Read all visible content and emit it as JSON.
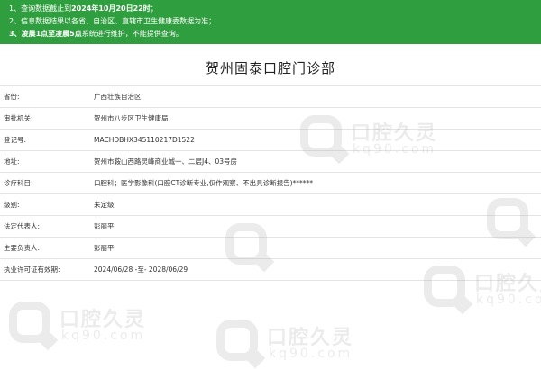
{
  "notice": {
    "lines": [
      {
        "prefix": "1、查询数据截止到",
        "date": "2024年10月20日22时",
        "suffix": "；"
      },
      {
        "text": "2、信息数据结果以各省、自治区、直辖市卫生健康委数据为准；"
      },
      {
        "bold": "3、凌晨1点至凌晨5点",
        "suffix": "系统进行维护，不能提供查询。"
      }
    ]
  },
  "title": "贺州固泰口腔门诊部",
  "rows": [
    {
      "label": "省份:",
      "value": "广西壮族自治区"
    },
    {
      "label": "审批机关:",
      "value": "贺州市八步区卫生健康局"
    },
    {
      "label": "登记号:",
      "value": "MACHDBHX345110217D1522"
    },
    {
      "label": "地址:",
      "value": "贺州市鞍山西路灵峰商业城一、二层J4、03号房"
    },
    {
      "label": "诊疗科目:",
      "value": "口腔科；医学影像科(口腔CT诊断专业,仅作观察、不出具诊断报告)******"
    },
    {
      "label": "级别:",
      "value": "未定级"
    },
    {
      "label": "法定代表人:",
      "value": "彭丽平"
    },
    {
      "label": "主要负责人:",
      "value": "彭丽平"
    },
    {
      "label": "执业许可证有效期:",
      "value": "2024/06/28 -至- 2028/06/29"
    }
  ],
  "watermark": {
    "brand": "口腔久灵",
    "site": "kq90.com"
  }
}
